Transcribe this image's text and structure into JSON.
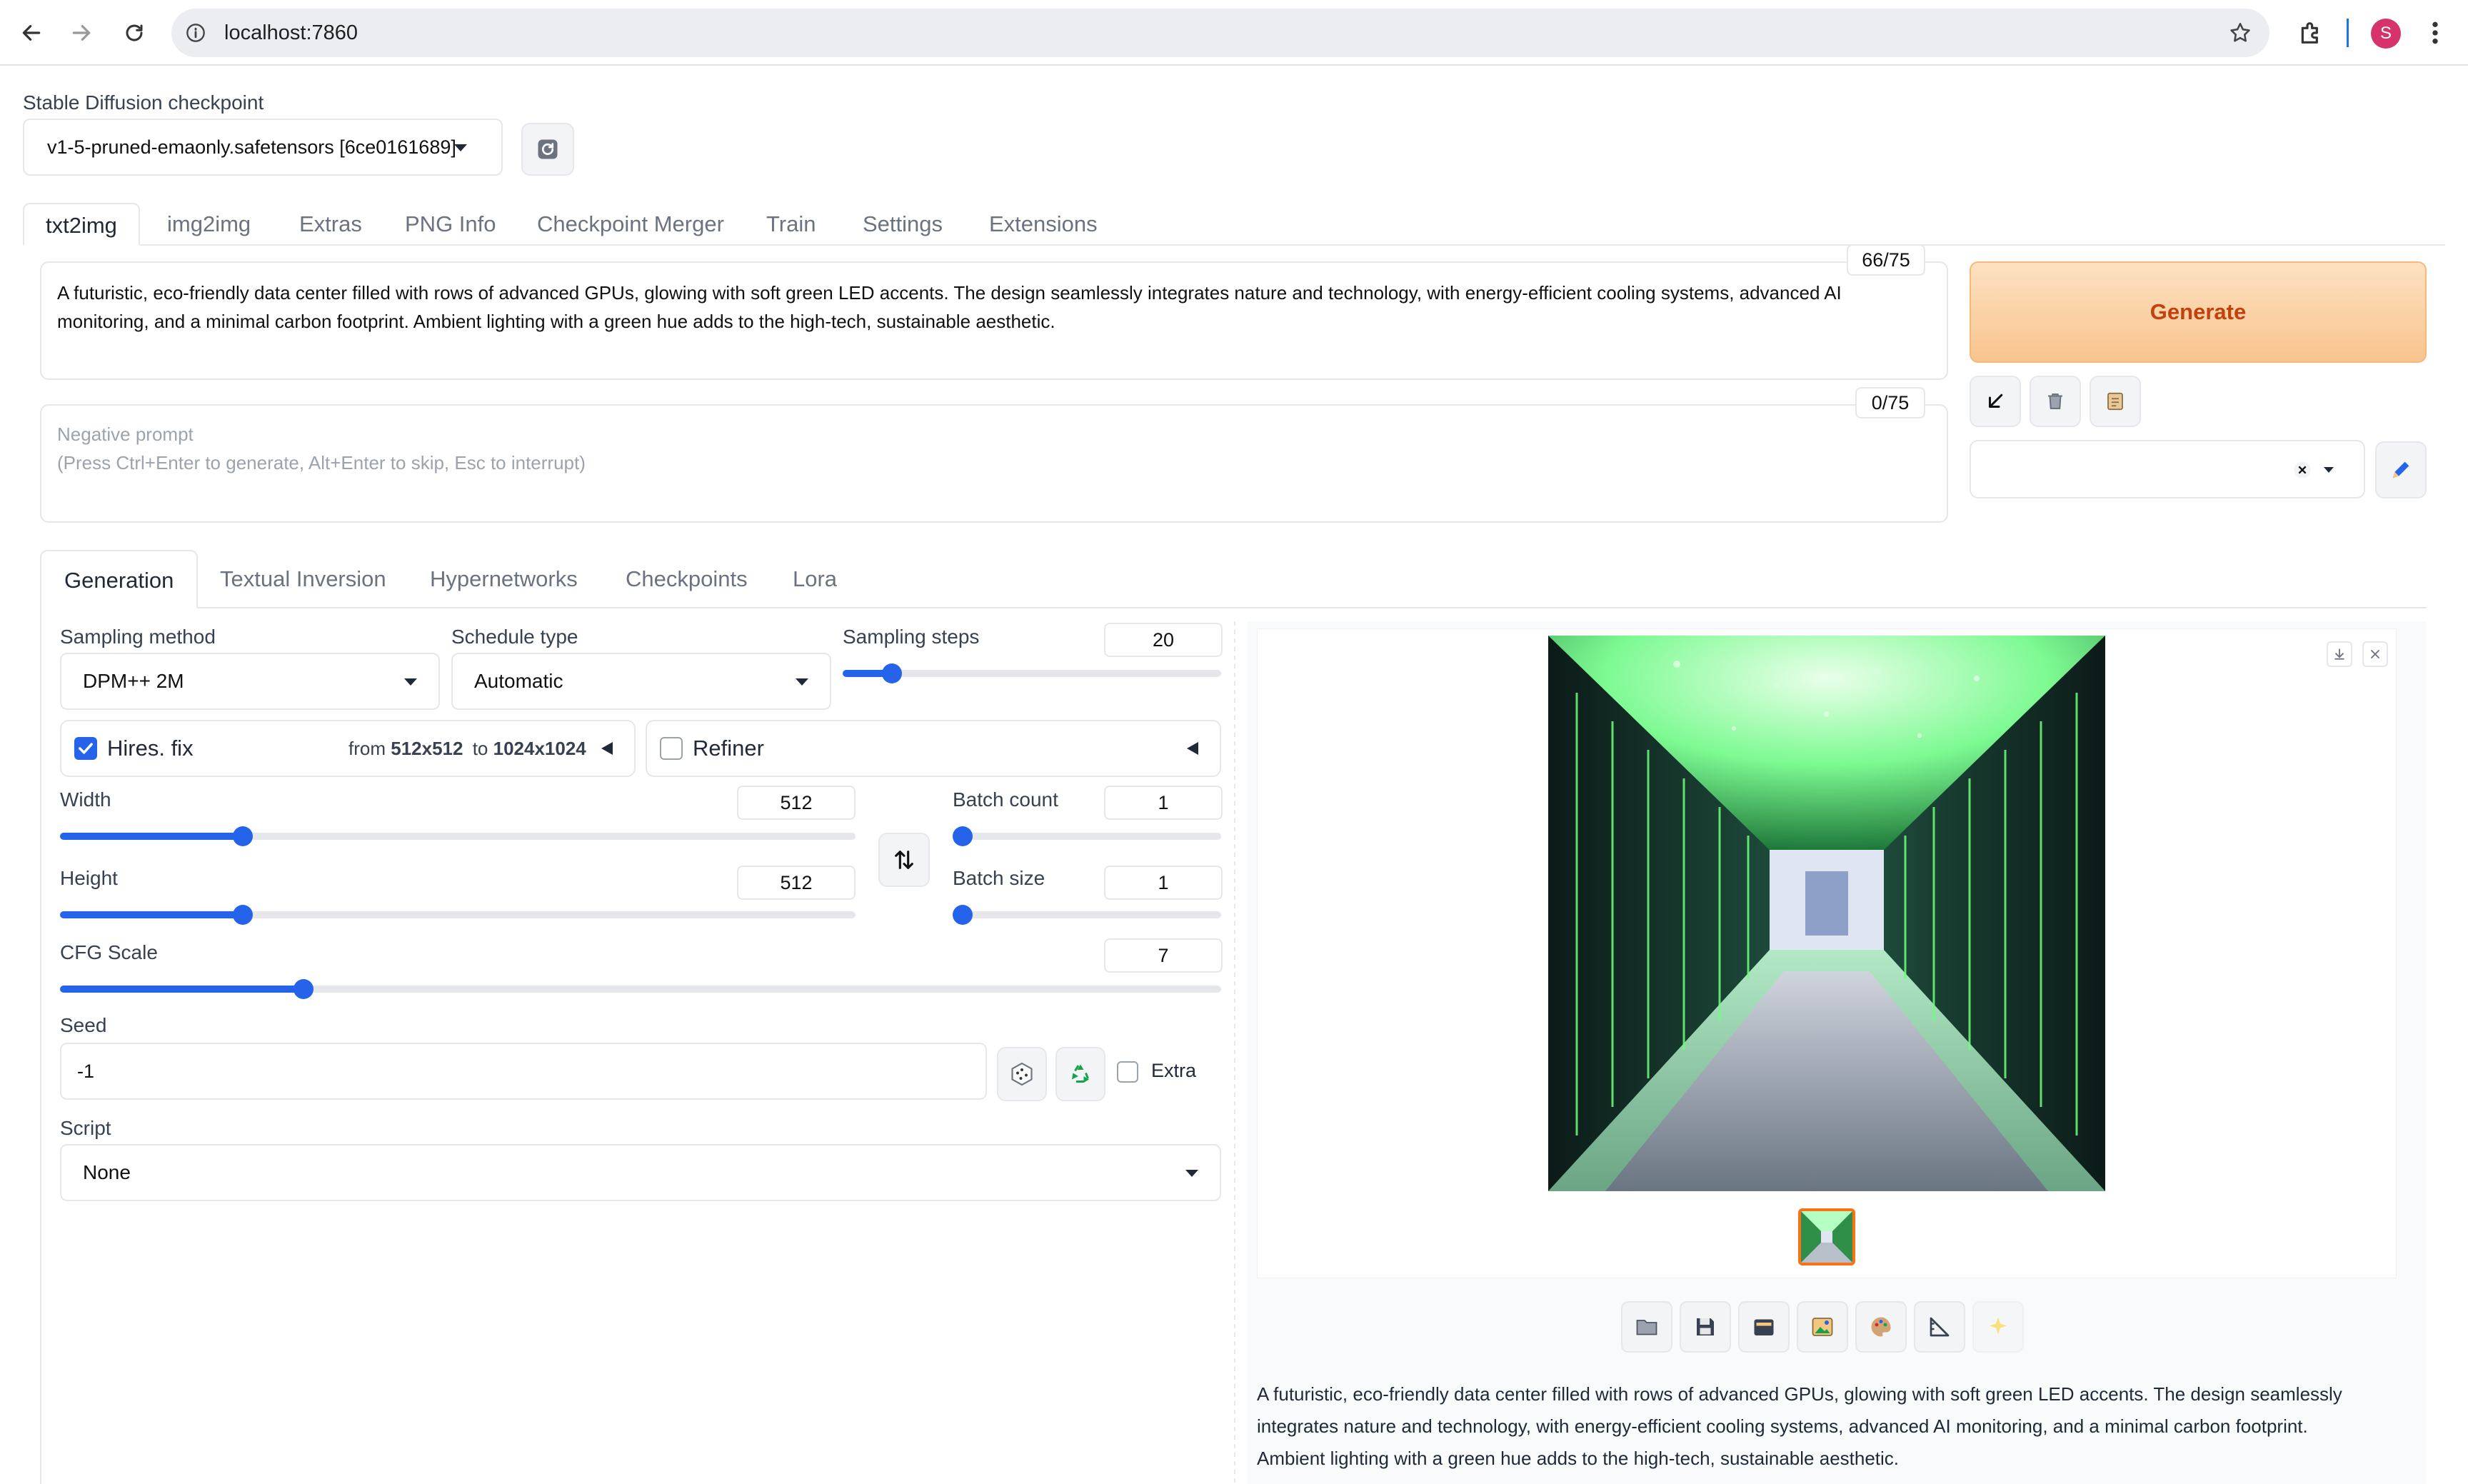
{
  "browser": {
    "url": "localhost:7860",
    "profile_initial": "S"
  },
  "checkpoint": {
    "label": "Stable Diffusion checkpoint",
    "value": "v1-5-pruned-emaonly.safetensors [6ce0161689]"
  },
  "tabs": [
    "txt2img",
    "img2img",
    "Extras",
    "PNG Info",
    "Checkpoint Merger",
    "Train",
    "Settings",
    "Extensions"
  ],
  "prompt": {
    "text_line1": "A futuristic, eco-friendly data center filled with rows of advanced GPUs, glowing with soft green LED accents. The design seamlessly integrates nature and technology, with energy-efficient cooling systems, advanced AI",
    "text_line2": "monitoring, and a minimal carbon footprint. Ambient lighting with a green hue adds to the high-tech, sustainable aesthetic.",
    "token_count": "66/75"
  },
  "negative_prompt": {
    "placeholder_line1": "Negative prompt",
    "placeholder_line2": "(Press Ctrl+Enter to generate, Alt+Enter to skip, Esc to interrupt)",
    "token_count": "0/75"
  },
  "generate_label": "Generate",
  "sub_tabs": [
    "Generation",
    "Textual Inversion",
    "Hypernetworks",
    "Checkpoints",
    "Lora"
  ],
  "sampling": {
    "method_label": "Sampling method",
    "method_value": "DPM++ 2M",
    "schedule_label": "Schedule type",
    "schedule_value": "Automatic",
    "steps_label": "Sampling steps",
    "steps_value": "20",
    "steps_fraction": 0.13
  },
  "hires": {
    "label": "Hires. fix",
    "checked": true,
    "from_prefix": "from",
    "from_value": "512x512",
    "to_prefix": "to",
    "to_value": "1024x1024"
  },
  "refiner": {
    "label": "Refiner",
    "checked": false
  },
  "width": {
    "label": "Width",
    "value": "512",
    "fraction": 0.23
  },
  "height": {
    "label": "Height",
    "value": "512",
    "fraction": 0.23
  },
  "batch_count": {
    "label": "Batch count",
    "value": "1",
    "fraction": 0
  },
  "batch_size": {
    "label": "Batch size",
    "value": "1",
    "fraction": 0
  },
  "cfg": {
    "label": "CFG Scale",
    "value": "7",
    "fraction": 0.21
  },
  "seed": {
    "label": "Seed",
    "value": "-1",
    "extra_label": "Extra"
  },
  "script": {
    "label": "Script",
    "value": "None"
  },
  "output_caption_line1": "A futuristic, eco-friendly data center filled with rows of advanced GPUs, glowing with soft green LED accents. The design seamlessly",
  "output_caption_line2": "integrates nature and technology, with energy-efficient cooling systems, advanced AI monitoring, and a minimal carbon footprint.",
  "output_caption_line3": "Ambient lighting with a green hue adds to the high-tech, sustainable aesthetic.",
  "colors": {
    "accent": "#2563eb",
    "generate_bg": "#f8c48e",
    "generate_text": "#c2410c",
    "profile": "#d6336c"
  }
}
